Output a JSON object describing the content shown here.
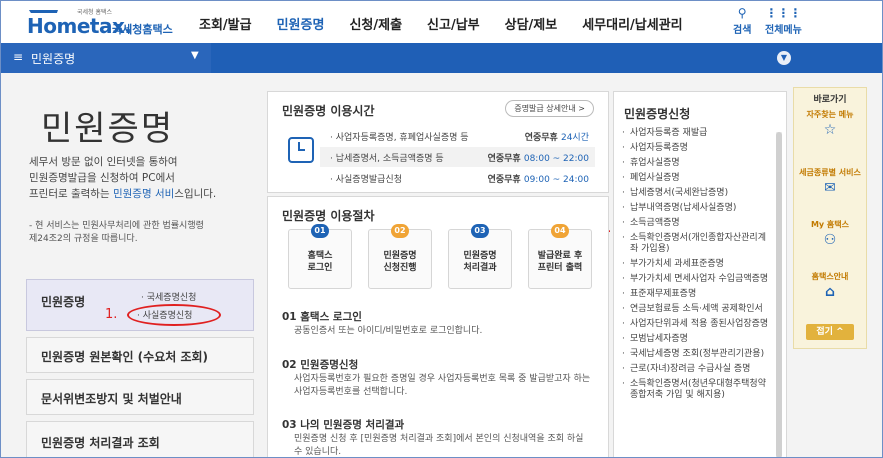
{
  "header": {
    "logo_small": "국세청 홈택스",
    "logo_word": "Hometax.",
    "logo_org": "국세청홈택스",
    "nav": [
      "조회/발급",
      "민원증명",
      "신청/제출",
      "신고/납부",
      "상담/제보",
      "세무대리/납세관리"
    ],
    "search_label": "검색",
    "allmenu_label": "전체메뉴"
  },
  "bluebar": {
    "menu_icon": "≡",
    "title": "민원증명"
  },
  "left": {
    "big_title": "민원증명",
    "intro_line1": "세무서 방문 없이 인터넷을 통하여",
    "intro_line2": "민원증명발급을 신청하여 PC에서",
    "intro_line3_a": "프린터로 출력하는 ",
    "intro_line3_link": "민원증명 서비",
    "intro_line3_b": "스입니다.",
    "note_line1": "- 현 서비스는 민원사무처리에 관한 법률시행령",
    "note_line2": "제24조2의 규정을 따릅니다.",
    "menu": [
      {
        "label": "민원증명",
        "sub": [
          "국세증명신청",
          "사실증명신청"
        ]
      },
      {
        "label": "민원증명 원본확인 (수요처 조회)"
      },
      {
        "label": "문서위변조방지 및 처벌안내"
      },
      {
        "label": "민원증명 처리결과 조회"
      }
    ]
  },
  "annotations": {
    "one": "1.",
    "two": "2."
  },
  "hours": {
    "title": "민원증명 이용시간",
    "detail_button": "증명발급 상세안내 >",
    "rows": [
      {
        "name": "사업자등록증명, 휴폐업사실증명 등",
        "prefix": "연중무휴 ",
        "time": "24시간"
      },
      {
        "name": "납세증명서, 소득금액증명 등",
        "prefix": "연중무휴 ",
        "time": "08:00 ~ 22:00"
      },
      {
        "name": "사실증명발급신청",
        "prefix": "연중무휴 ",
        "time": "09:00 ~ 24:00"
      }
    ]
  },
  "procedure": {
    "title": "민원증명 이용절차",
    "steps": [
      {
        "num": "01",
        "line1": "홈택스",
        "line2": "로그인"
      },
      {
        "num": "02",
        "line1": "민원증명",
        "line2": "신청진행"
      },
      {
        "num": "03",
        "line1": "민원증명",
        "line2": "처리결과"
      },
      {
        "num": "04",
        "line1": "발급완료 후",
        "line2": "프린터 출력"
      }
    ],
    "items": [
      {
        "title": "01 홈택스 로그인",
        "desc": "공동인증서 또는 아이디/비밀번호로 로그인합니다."
      },
      {
        "title": "02 민원증명신청",
        "desc": "사업자등록번호가 필요한 증명일 경우 사업자등록번호 목록 중 발급받고자 하는 사업자등록번호를 선택합니다."
      },
      {
        "title": "03 나의 민원증명 처리결과",
        "desc": "민원증명 신청 후 [민원증명 처리결과 조회]에서 본인의 신청내역을 조회 하실 수 있습니다."
      }
    ]
  },
  "apply": {
    "title": "민원증명신청",
    "items": [
      "사업자등록증 재발급",
      "사업자등록증명",
      "휴업사실증명",
      "폐업사실증명",
      "납세증명서(국세완납증명)",
      "납부내역증명(납세사실증명)",
      "소득금액증명",
      "소득확인증명서(개인종합자산관리계좌 가입용)",
      "부가가치세 과세표준증명",
      "부가가치세 면세사업자 수입금액증명",
      "표준재무제표증명",
      "연금보험료등 소득·세액 공제확인서",
      "사업자단위과세 적용 종된사업장증명",
      "모범납세자증명",
      "국세납세증명 조회(정부관리기관용)",
      "근로(자녀)장려금 수급사실 증명",
      "소득확인증명서(청년우대형주택청약종합저축 가입 및 해지용)"
    ]
  },
  "quick": {
    "title": "바로가기",
    "items": [
      {
        "label": "자주찾는 메뉴",
        "icon": "☆"
      },
      {
        "label": "세금종류별 서비스",
        "icon": "✉"
      },
      {
        "label": "My 홈택스",
        "icon": "⚇"
      },
      {
        "label": "홈택스안내",
        "icon": "⌂"
      }
    ],
    "close": "접기 ^"
  }
}
